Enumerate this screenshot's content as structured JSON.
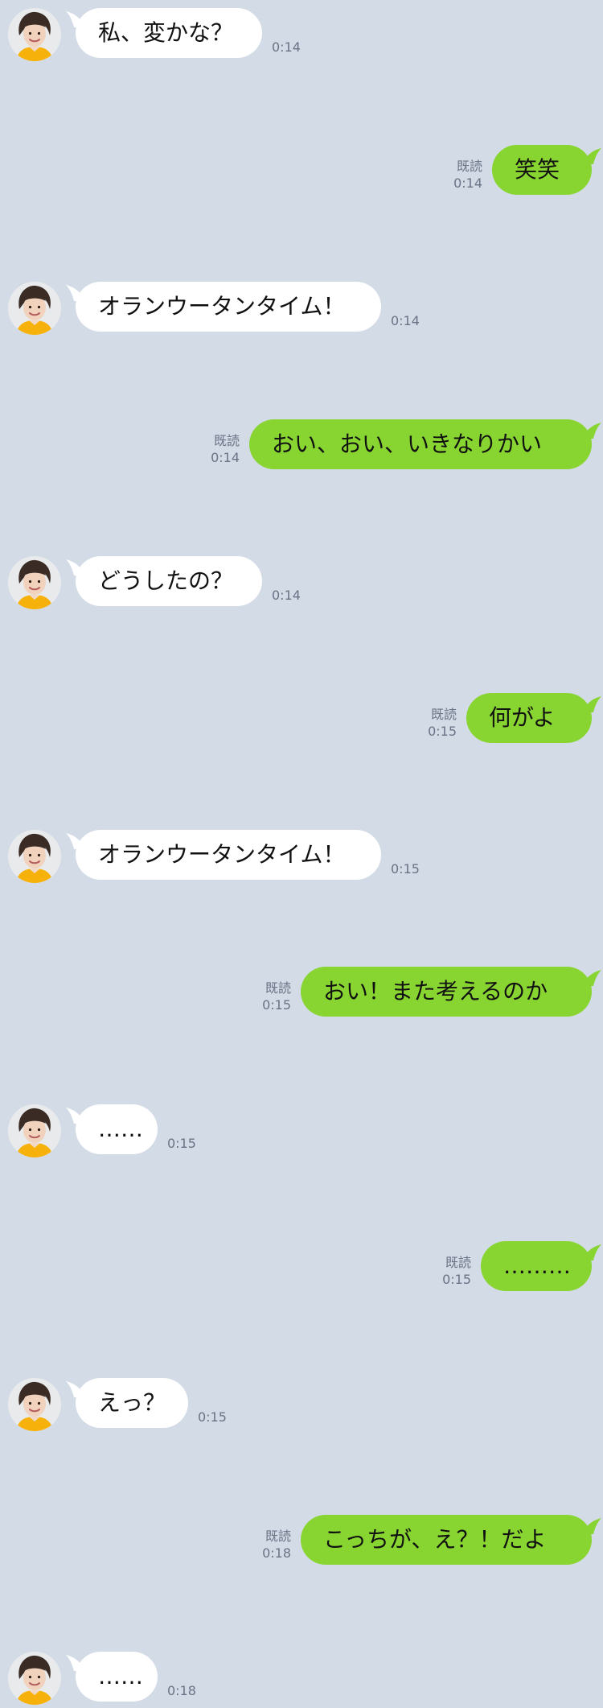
{
  "contact": {
    "avatar_icon": "woman-portrait-avatar"
  },
  "colors": {
    "background": "#d3dbe6",
    "incoming_bubble": "#ffffff",
    "outgoing_bubble": "#88d532"
  },
  "messages": [
    {
      "direction": "in",
      "text": "私、変かな？",
      "time": "0:14"
    },
    {
      "direction": "out",
      "text": "笑笑",
      "time": "0:14",
      "read": "既読"
    },
    {
      "direction": "in",
      "text": "オランウータンタイム！",
      "time": "0:14"
    },
    {
      "direction": "out",
      "text": "おい、おい、いきなりかい",
      "time": "0:14",
      "read": "既読"
    },
    {
      "direction": "in",
      "text": "どうしたの？",
      "time": "0:14"
    },
    {
      "direction": "out",
      "text": "何がよ",
      "time": "0:15",
      "read": "既読"
    },
    {
      "direction": "in",
      "text": "オランウータンタイム！",
      "time": "0:15"
    },
    {
      "direction": "out",
      "text": "おい！また考えるのか",
      "time": "0:15",
      "read": "既読"
    },
    {
      "direction": "in",
      "text": "……",
      "time": "0:15"
    },
    {
      "direction": "out",
      "text": "………",
      "time": "0:15",
      "read": "既読"
    },
    {
      "direction": "in",
      "text": "えっ？",
      "time": "0:15"
    },
    {
      "direction": "out",
      "text": "こっちが、え？！だよ",
      "time": "0:18",
      "read": "既読"
    },
    {
      "direction": "in",
      "text": "……",
      "time": "0:18"
    }
  ]
}
